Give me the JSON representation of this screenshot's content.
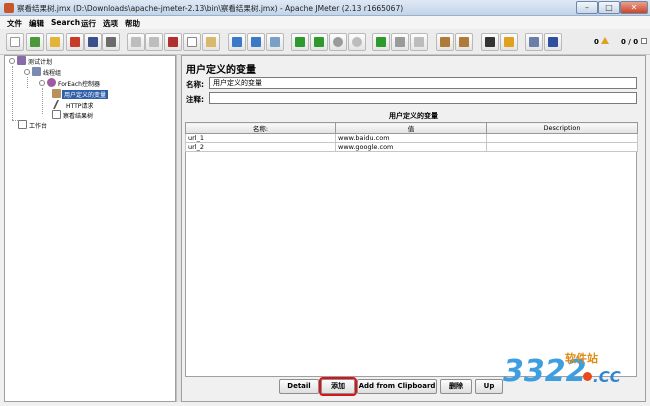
{
  "window": {
    "title": "察看结果树.jmx (D:\\Downloads\\apache-jmeter-2.13\\bin\\察看结果树.jmx) - Apache JMeter (2.13 r1665067)",
    "controls": [
      "–",
      "□",
      "✕"
    ]
  },
  "menu": [
    "文件",
    "编辑",
    "Search",
    "运行",
    "选项",
    "帮助"
  ],
  "toolbar": {
    "warning_count": "0",
    "thread_counter": "0 / 0"
  },
  "tree": {
    "items": [
      {
        "label": "测试计划",
        "icon": "test-plan-icon"
      },
      {
        "label": "线程组",
        "icon": "thread-group-icon"
      },
      {
        "label": "ForEach控制器",
        "icon": "foreach-controller-icon"
      },
      {
        "label": "用户定义的变量",
        "icon": "user-variables-icon"
      },
      {
        "label": "HTTP请求",
        "icon": "http-request-icon"
      },
      {
        "label": "察看结果树",
        "icon": "result-tree-icon"
      },
      {
        "label": "工作台",
        "icon": "workbench-icon"
      }
    ]
  },
  "panel": {
    "title": "用户定义的变量",
    "name_label": "名称:",
    "name_value": "用户定义的变量",
    "comment_label": "注释:",
    "comment_value": "",
    "table_caption": "用户定义的变量",
    "columns": [
      "名称:",
      "值",
      "Description"
    ],
    "rows": [
      [
        "url_1",
        "www.baidu.com",
        ""
      ],
      [
        "url_2",
        "www.google.com",
        ""
      ]
    ]
  },
  "buttons": {
    "detail": "Detail",
    "add": "添加",
    "add_clipboard": "Add from Clipboard",
    "delete": "删除",
    "up": "Up"
  },
  "watermark": {
    "logo": "3322",
    "site": "软件站",
    "domain": ".CC"
  },
  "colors": {
    "selection": "#2f5fa8",
    "highlight": "#d8141a"
  }
}
